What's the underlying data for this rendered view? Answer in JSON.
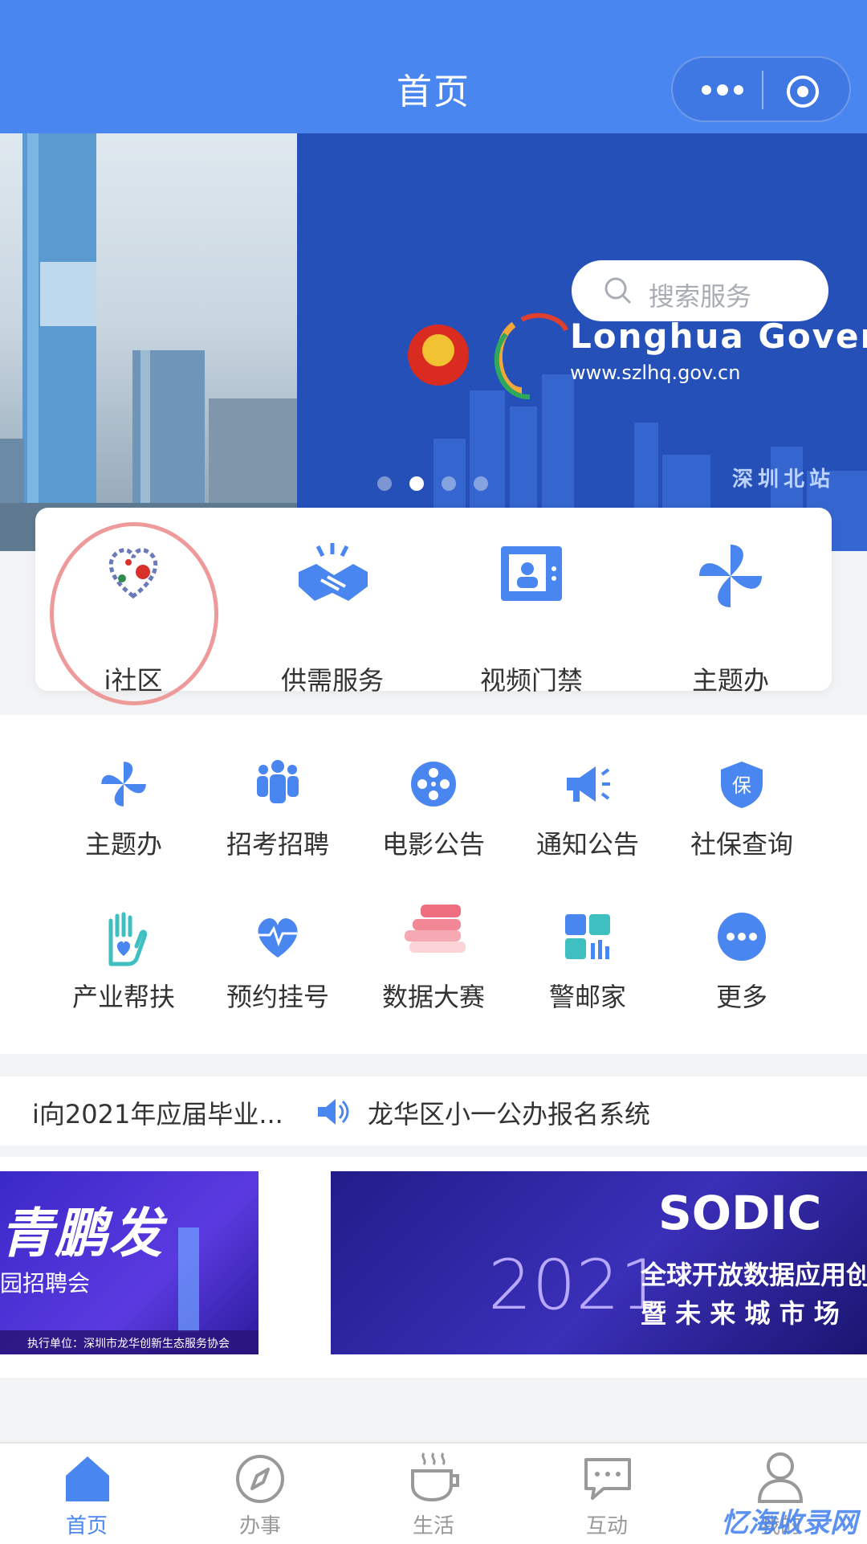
{
  "header": {
    "title": "首页"
  },
  "banner": {
    "search_placeholder": "搜索服务",
    "gov_title": "Longhua Govern",
    "gov_url": "www.szlhq.gov.cn",
    "station_label": "深圳北站",
    "active_slide": 1,
    "slide_count": 4
  },
  "quick": [
    {
      "label": "i社区",
      "icon": "heart-community-icon"
    },
    {
      "label": "供需服务",
      "icon": "handshake-icon"
    },
    {
      "label": "视频门禁",
      "icon": "video-door-icon"
    },
    {
      "label": "主题办",
      "icon": "pinwheel-icon"
    }
  ],
  "grid": [
    {
      "label": "主题办",
      "icon": "pinwheel-icon"
    },
    {
      "label": "招考招聘",
      "icon": "people-icon"
    },
    {
      "label": "电影公告",
      "icon": "film-reel-icon"
    },
    {
      "label": "通知公告",
      "icon": "megaphone-icon"
    },
    {
      "label": "社保查询",
      "icon": "shield-bao-icon"
    },
    {
      "label": "产业帮扶",
      "icon": "hand-heart-icon"
    },
    {
      "label": "预约挂号",
      "icon": "heartbeat-icon"
    },
    {
      "label": "数据大赛",
      "icon": "books-icon"
    },
    {
      "label": "警邮家",
      "icon": "grid-apps-icon"
    },
    {
      "label": "更多",
      "icon": "more-dots-icon"
    }
  ],
  "news": {
    "item_a": "i向2021年应届毕业...",
    "item_b": "龙华区小一公办报名系统"
  },
  "promo": {
    "left_title": "青鹏发",
    "left_subtitle": "园招聘会",
    "left_footer": "执行单位：深圳市龙华创新生态服务协会",
    "right_brand": "SODIC",
    "right_year": "2021",
    "right_line1": "全球开放数据应用创",
    "right_line2": "暨 未 来 城 市 场"
  },
  "tabs": [
    {
      "label": "首页",
      "icon": "home-icon",
      "active": true
    },
    {
      "label": "办事",
      "icon": "compass-icon",
      "active": false
    },
    {
      "label": "生活",
      "icon": "coffee-icon",
      "active": false
    },
    {
      "label": "互动",
      "icon": "chat-icon",
      "active": false
    },
    {
      "label": "我的",
      "icon": "user-icon",
      "active": false
    }
  ],
  "watermark": "忆海收录网",
  "colors": {
    "primary": "#4a86f0",
    "highlight_ring": "#ee9a9a",
    "text": "#333333",
    "tab_inactive": "#999999"
  }
}
